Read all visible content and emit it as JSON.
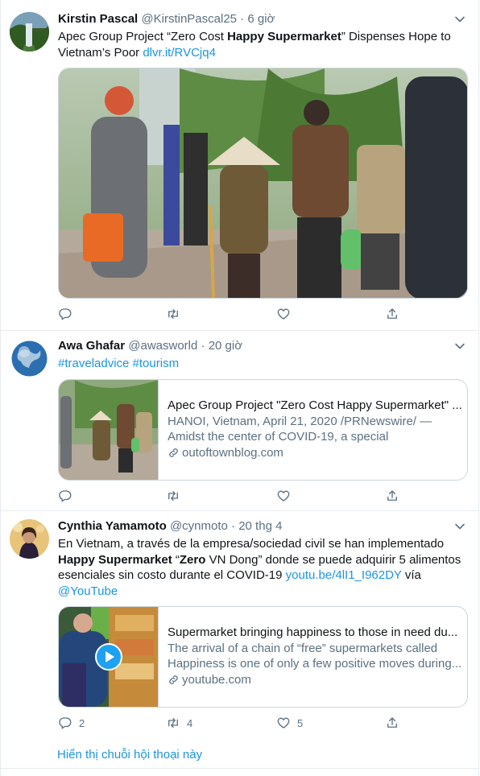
{
  "tweets": [
    {
      "name": "Kirstin Pascal",
      "handle": "@KirstinPascal25",
      "separator": "·",
      "time": "6 giờ",
      "text_pre": "Apec Group Project “Zero Cost ",
      "text_bold": "Happy Supermarket",
      "text_post": "” Dispenses Hope to Vietnam’s Poor ",
      "link": "dlvr.it/RVCjq4",
      "media_alt": "Elderly woman in conical hat walking with cane among people on sidewalk"
    },
    {
      "name": "Awa Ghafar",
      "handle": "@awasworld",
      "separator": "·",
      "time": "20 giờ",
      "hashtags": "#traveladvice #tourism",
      "card": {
        "title": "Apec Group Project \"Zero Cost Happy Supermarket\" ...",
        "desc": "HANOI, Vietnam, April 21, 2020 /PRNewswire/ — Amidst the center of COVID-19, a special supermarke...",
        "domain": "outoftownblog.com"
      }
    },
    {
      "name": "Cynthia Yamamoto",
      "handle": "@cynmoto",
      "separator": "·",
      "time": "20 thg 4",
      "line1": "En Vietnam, a través de la empresa/sociedad civil se han implementado",
      "line2_bold1": "Happy Supermarket",
      "line2_mid": " “",
      "line2_bold2": "Zero",
      "line2_post": " VN Dong” donde se puede adquirir 5 alimentos",
      "line3_pre": "esenciales sin costo durante el COVID-19 ",
      "line3_link": "youtu.be/4lI1_I962DY",
      "line3_post": " vía",
      "line4_link": "@YouTube",
      "card": {
        "title": "Supermarket bringing happiness to those in need du...",
        "desc": "The arrival of a chain of “free” supermarkets called Happiness is one of only a few positive moves during...",
        "domain": "youtube.com"
      },
      "replies": "2",
      "retweets": "4",
      "likes": "5"
    }
  ],
  "show_thread": "Hiển thị chuỗi hội thoại này",
  "icons": [
    "chevron-down-icon",
    "reply-icon",
    "retweet-icon",
    "like-icon",
    "share-icon",
    "link-icon",
    "play-icon"
  ],
  "colors": {
    "link": "#1b95e0",
    "secondary": "#5b7083",
    "border": "#e6ecf0"
  }
}
